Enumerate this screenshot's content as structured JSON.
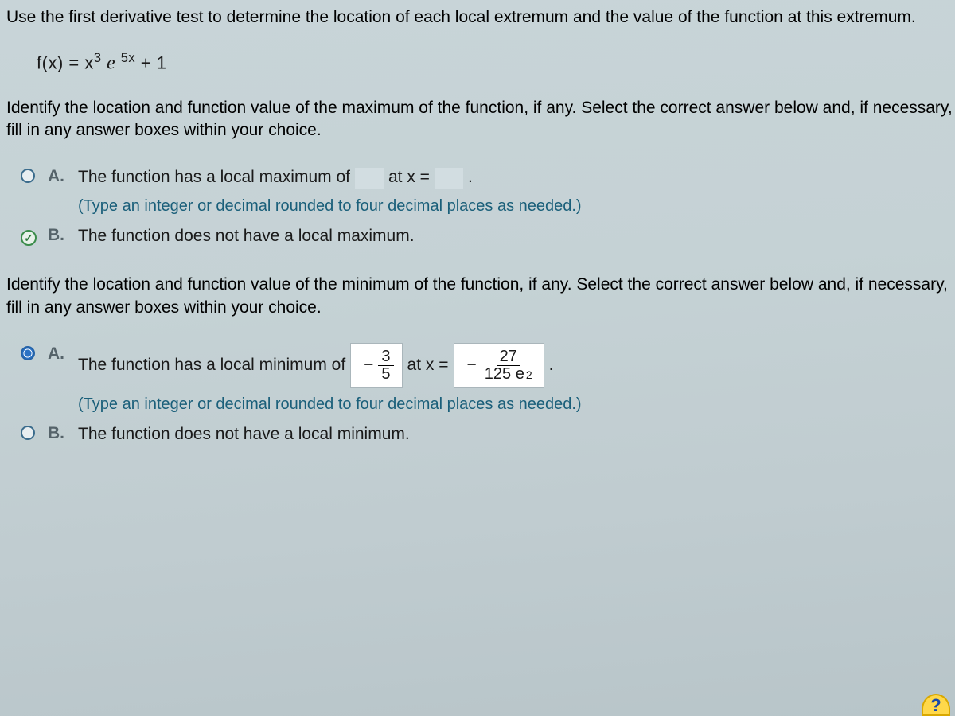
{
  "problem": {
    "statement": "Use the first derivative test to determine the location of each local extremum and the value of the function at this extremum.",
    "function_lhs": "f(x) = x",
    "function_exp1": "3",
    "function_mid": " e ",
    "function_exp2": "5x",
    "function_tail": " + 1"
  },
  "sections": {
    "max": {
      "instruction": "Identify the location and function value of the maximum of the function, if any. Select the correct answer below and, if necessary, fill in any answer boxes within your choice.",
      "A": {
        "letter": "A.",
        "text_pre": "The function has a local maximum of",
        "text_mid": "at x =",
        "period": ".",
        "hint": "(Type an integer or decimal rounded to four decimal places as needed.)"
      },
      "B": {
        "letter": "B.",
        "text": "The function does not have a local maximum."
      }
    },
    "min": {
      "instruction": "Identify the location and function value of the minimum of the function, if any. Select the correct answer below and, if necessary, fill in any answer boxes within your choice.",
      "A": {
        "letter": "A.",
        "text_pre": "The function has a local minimum of",
        "box1_neg": "−",
        "box1_num": "3",
        "box1_den": "5",
        "text_mid": "at x =",
        "box2_neg": "−",
        "box2_num": "27",
        "box2_den_a": "125 e",
        "box2_den_exp": "2",
        "period": ".",
        "hint": "(Type an integer or decimal rounded to four decimal places as needed.)"
      },
      "B": {
        "letter": "B.",
        "text": "The function does not have a local minimum."
      }
    }
  },
  "icons": {
    "check": "✓",
    "help": "?"
  }
}
